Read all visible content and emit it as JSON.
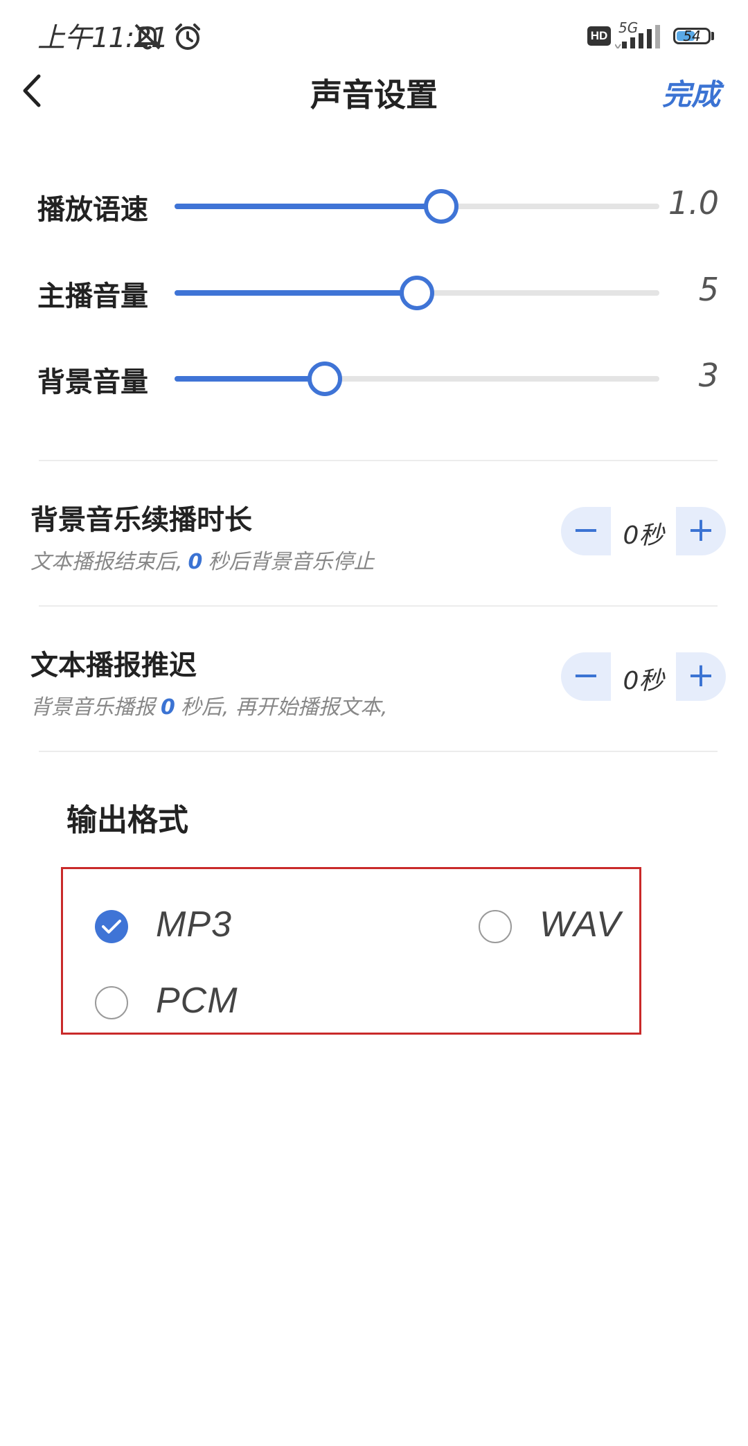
{
  "status_bar": {
    "time": "上午11:21",
    "hd_label": "HD",
    "network_label": "5G",
    "battery_level": "54",
    "icons": [
      "mute-icon",
      "alarm-icon",
      "signal-icon",
      "battery-icon"
    ]
  },
  "header": {
    "title": "声音设置",
    "done_label": "完成",
    "back_icon": "chevron-left-icon"
  },
  "sliders": [
    {
      "label": "播放语速",
      "value": "1.0",
      "fill_fraction": 0.55
    },
    {
      "label": "主播音量",
      "value": "5",
      "fill_fraction": 0.5
    },
    {
      "label": "背景音量",
      "value": "3",
      "fill_fraction": 0.31
    }
  ],
  "bgm_duration": {
    "title": "背景音乐续播时长",
    "desc_prefix": "文本播报结束后,",
    "desc_value": "0",
    "desc_suffix": "秒后背景音乐停止",
    "stepper_value": "0秒",
    "minus_label": "−",
    "plus_label": "+"
  },
  "text_delay": {
    "title": "文本播报推迟",
    "desc_prefix": "背景音乐播报",
    "desc_value": "0",
    "desc_suffix": "秒后, 再开始播报文本,",
    "stepper_value": "0秒",
    "minus_label": "−",
    "plus_label": "+"
  },
  "output_format": {
    "title": "输出格式",
    "options": [
      {
        "label": "MP3",
        "checked": true
      },
      {
        "label": "WAV",
        "checked": false
      },
      {
        "label": "PCM",
        "checked": false
      }
    ]
  },
  "colors": {
    "accent": "#3f74d6",
    "highlight_border": "#c92a2a",
    "stepper_bg": "#e6edfb"
  }
}
